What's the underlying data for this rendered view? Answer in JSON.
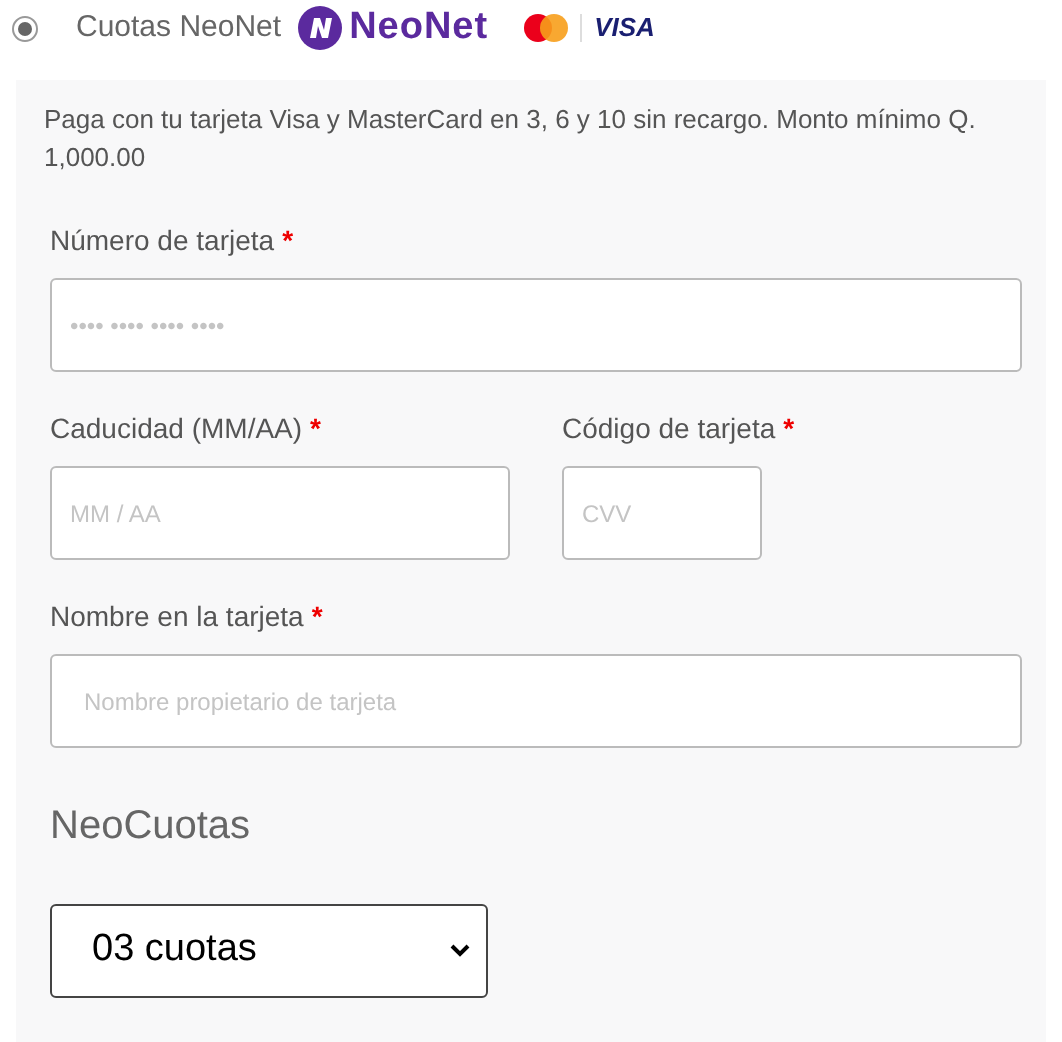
{
  "payment_option": {
    "selected": true,
    "label": "Cuotas NeoNet",
    "logo_text": "NeoNet",
    "card_brands": [
      "VISA"
    ]
  },
  "panel": {
    "description": "Paga con tu tarjeta Visa y MasterCard en 3, 6 y 10 sin recargo. Monto mínimo Q. 1,000.00",
    "fields": [
      {
        "label": "Número de tarjeta",
        "required_mark": "*",
        "placeholder": "•••• •••• •••• ••••",
        "kind": "full"
      },
      {
        "label": "Caducidad (MM/AA)",
        "required_mark": "*",
        "placeholder": "MM / AA",
        "kind": "half"
      },
      {
        "label": "Código de tarjeta",
        "required_mark": "*",
        "placeholder": "CVV",
        "kind": "small"
      },
      {
        "label": "Nombre en la tarjeta",
        "required_mark": "*",
        "placeholder": "Nombre propietario de tarjeta",
        "kind": "full"
      }
    ],
    "section_title": "NeoCuotas",
    "installments_select": {
      "value": "03 cuotas"
    }
  }
}
